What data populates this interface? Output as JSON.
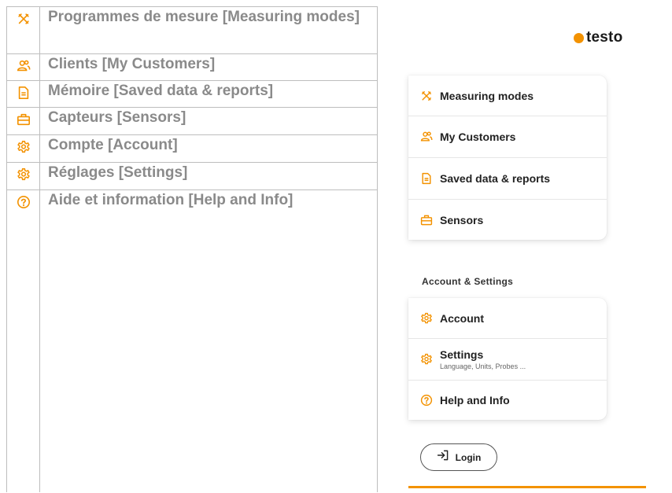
{
  "doc_rows": [
    {
      "icon": "measuring-modes-icon",
      "text": "Programmes de mesure [Measuring modes]"
    },
    {
      "icon": "customers-icon",
      "text": "Clients [My Customers]"
    },
    {
      "icon": "document-icon",
      "text": "Mémoire [Saved data & reports]"
    },
    {
      "icon": "sensors-icon",
      "text": "Capteurs [Sensors]"
    },
    {
      "icon": "gear-icon",
      "text": "Compte [Account]"
    },
    {
      "icon": "gear-icon",
      "text": "Réglages [Settings]"
    },
    {
      "icon": "help-icon",
      "text": "Aide et information [Help and Info]"
    }
  ],
  "app": {
    "logo": "testo",
    "main_menu": [
      {
        "icon": "measuring-modes-icon",
        "label": "Measuring modes"
      },
      {
        "icon": "customers-icon",
        "label": "My Customers"
      },
      {
        "icon": "document-icon",
        "label": "Saved data & reports"
      },
      {
        "icon": "sensors-icon",
        "label": "Sensors"
      }
    ],
    "section_title": "Account & Settings",
    "settings_menu": [
      {
        "icon": "gear-icon",
        "label": "Account"
      },
      {
        "icon": "gear-icon",
        "label": "Settings",
        "sublabel": "Language, Units, Probes ..."
      },
      {
        "icon": "help-icon",
        "label": "Help and Info"
      }
    ],
    "login_label": "Login"
  },
  "colors": {
    "accent": "#f39200",
    "doc_text": "#8a8a8a",
    "border": "#bdbdbd"
  }
}
